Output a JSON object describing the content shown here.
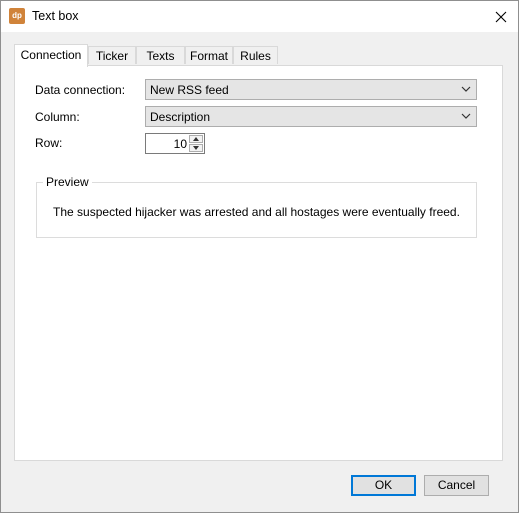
{
  "window": {
    "title": "Text box",
    "app_icon_text": "dp",
    "close_icon": "close-icon"
  },
  "tabs": [
    {
      "label": "Connection",
      "active": true
    },
    {
      "label": "Ticker",
      "active": false
    },
    {
      "label": "Texts",
      "active": false
    },
    {
      "label": "Format",
      "active": false
    },
    {
      "label": "Rules",
      "active": false
    }
  ],
  "connection": {
    "data_connection_label": "Data connection:",
    "data_connection_value": "New RSS feed",
    "column_label": "Column:",
    "column_value": "Description",
    "row_label": "Row:",
    "row_value": "10"
  },
  "preview": {
    "title": "Preview",
    "text": "The suspected hijacker was arrested and all hostages were eventually freed."
  },
  "buttons": {
    "ok": "OK",
    "cancel": "Cancel"
  },
  "colors": {
    "app_icon": "#d0833a",
    "default_button_border": "#0078d7"
  }
}
